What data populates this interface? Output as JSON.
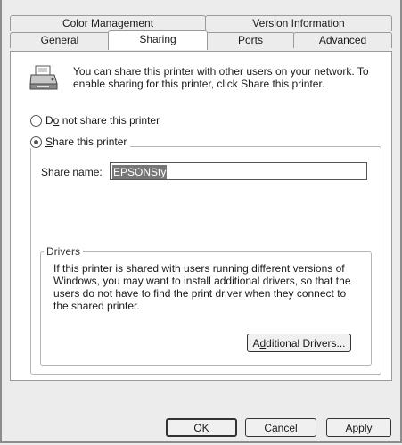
{
  "tabs_row1": [
    {
      "label": "Color Management"
    },
    {
      "label": "Version Information"
    }
  ],
  "tabs_row2": [
    {
      "label": "General"
    },
    {
      "label": "Sharing"
    },
    {
      "label": "Ports"
    },
    {
      "label": "Advanced"
    }
  ],
  "active_tab": "Sharing",
  "sharing": {
    "intro": "You can share this printer with other users on your network. To enable sharing for this printer, click Share this printer.",
    "do_not_share": {
      "pre": "D",
      "ul": "o",
      "post": " not share this printer",
      "checked": false
    },
    "share": {
      "pre": "",
      "ul": "S",
      "post": "hare this printer",
      "checked": true
    },
    "share_name_label": {
      "pre": "S",
      "ul": "h",
      "post": "are name:"
    },
    "share_name_value": "EPSONSty",
    "drivers_legend": "Drivers",
    "drivers_text": "If this printer is shared with users running different versions of Windows, you may want to install additional drivers, so that the users do not have to find the print driver when they connect to the shared printer.",
    "additional_drivers": {
      "pre": "A",
      "ul": "d",
      "post": "ditional Drivers..."
    }
  },
  "buttons": {
    "ok": "OK",
    "cancel": "Cancel",
    "apply": {
      "pre": "",
      "ul": "A",
      "post": "pply"
    }
  }
}
